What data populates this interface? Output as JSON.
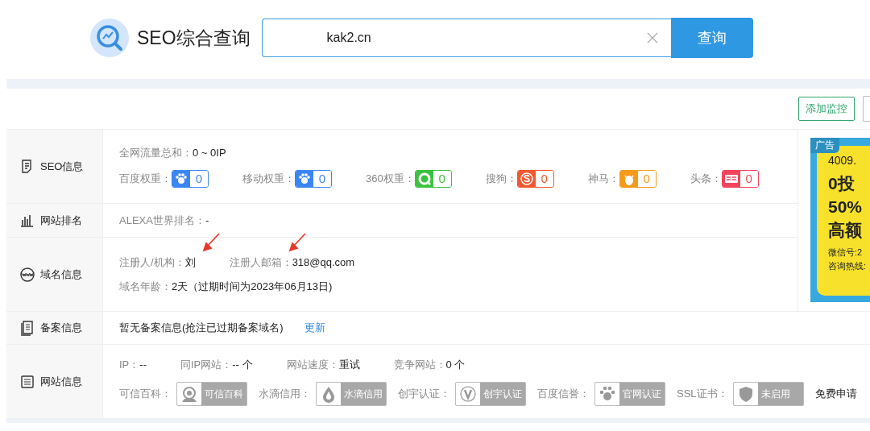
{
  "header": {
    "title": "SEO综合查询",
    "search": {
      "value": "kak2.cn"
    },
    "button": "查询"
  },
  "toolbar": {
    "buttons": [
      "添加监控"
    ]
  },
  "sections": [
    {
      "kind": "seo",
      "label": "SEO信息",
      "lines": [
        [
          {
            "kind": "field",
            "label": "全网流量总和：",
            "value": "0 ~ 0IP"
          }
        ],
        [
          {
            "kind": "weight",
            "label": "百度权重：",
            "value": "0",
            "color": "#3b86f5"
          },
          {
            "kind": "weight",
            "label": "移动权重：",
            "value": "0",
            "color": "#3b86f5"
          },
          {
            "kind": "weight",
            "label": "360权重：",
            "value": "0",
            "color": "#3cc23f"
          },
          {
            "kind": "weight",
            "label": "搜狗：",
            "value": "0",
            "color": "#f2572d"
          },
          {
            "kind": "weight",
            "label": "神马：",
            "value": "0",
            "color": "#f59a1b"
          },
          {
            "kind": "weight",
            "label": "头条：",
            "value": "0",
            "color": "#f0455a"
          }
        ]
      ]
    },
    {
      "kind": "rank",
      "label": "网站排名",
      "lines": [
        [
          {
            "kind": "field",
            "label": "ALEXA世界排名：",
            "value": "-"
          }
        ]
      ]
    },
    {
      "kind": "domain",
      "label": "域名信息",
      "lines": [
        [
          {
            "kind": "field",
            "label": "注册人/机构：",
            "value": "刘",
            "annotated": true
          },
          {
            "kind": "field",
            "label": "注册人邮箱：",
            "value": "318@qq.com",
            "annotated": true
          }
        ],
        [
          {
            "kind": "field",
            "label": "域名年龄：",
            "value": "2天（过期时间为2023年06月13日)"
          }
        ]
      ]
    },
    {
      "kind": "icp",
      "label": "备案信息",
      "lines": [
        [
          {
            "kind": "text",
            "value": "暂无备案信息(抢注已过期备案域名)"
          },
          {
            "kind": "link",
            "value": "更新"
          }
        ]
      ]
    },
    {
      "kind": "site",
      "label": "网站信息",
      "lines": [
        [
          {
            "kind": "field",
            "label": "IP：",
            "value": "--"
          },
          {
            "kind": "field",
            "label": "同IP网站：",
            "value": "-- 个"
          },
          {
            "kind": "field",
            "label": "网站速度：",
            "value": "重试"
          },
          {
            "kind": "field",
            "label": "竞争网站：",
            "value": "0 个"
          }
        ],
        [
          {
            "kind": "badge",
            "label": "可信百科：",
            "value": "可信百科"
          },
          {
            "kind": "badge",
            "label": "水滴信用：",
            "value": "水滴信用"
          },
          {
            "kind": "badge",
            "label": "创宇认证：",
            "value": "创宇认证"
          },
          {
            "kind": "badge",
            "label": "百度信誉：",
            "value": "官网认证"
          },
          {
            "kind": "badge",
            "label": "SSL证书：",
            "value": "未启用"
          },
          {
            "kind": "action",
            "value": "免费申请"
          }
        ]
      ]
    }
  ],
  "ad": {
    "tag": "广告",
    "lines": [
      {
        "kind": "small",
        "value": "4009."
      },
      {
        "kind": "big",
        "value": "0投"
      },
      {
        "kind": "big",
        "value": "50%"
      },
      {
        "kind": "big",
        "value": "高额"
      },
      {
        "kind": "note",
        "value": "微信号:2"
      },
      {
        "kind": "note",
        "value": "咨询热线:"
      }
    ]
  }
}
